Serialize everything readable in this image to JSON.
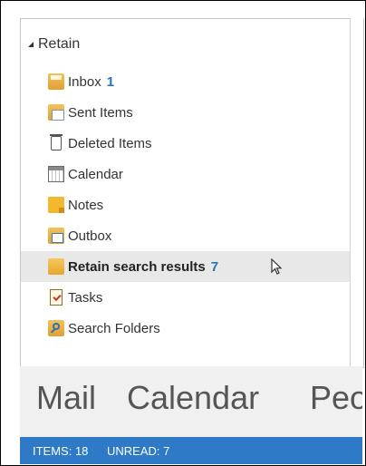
{
  "folder_tree": {
    "header": "Retain",
    "items": [
      {
        "label": "Inbox",
        "count": "1",
        "icon": "inbox-icon"
      },
      {
        "label": "Sent Items",
        "count": "",
        "icon": "sent-items-icon"
      },
      {
        "label": "Deleted Items",
        "count": "",
        "icon": "deleted-items-icon"
      },
      {
        "label": "Calendar",
        "count": "",
        "icon": "calendar-icon"
      },
      {
        "label": "Notes",
        "count": "",
        "icon": "notes-icon"
      },
      {
        "label": "Outbox",
        "count": "",
        "icon": "outbox-icon"
      },
      {
        "label": "Retain search results",
        "count": "7",
        "icon": "retain-search-results-icon",
        "selected": true
      },
      {
        "label": "Tasks",
        "count": "",
        "icon": "tasks-icon"
      },
      {
        "label": "Search Folders",
        "count": "",
        "icon": "search-folders-icon"
      }
    ]
  },
  "nav": {
    "mail": "Mail",
    "calendar": "Calendar",
    "people": "Peo"
  },
  "status": {
    "items": "ITEMS: 18",
    "unread": "UNREAD: 7"
  },
  "colors": {
    "accent": "#2f7ac7",
    "count": "#1f73c8",
    "selected_row": "#e8e8e8"
  }
}
